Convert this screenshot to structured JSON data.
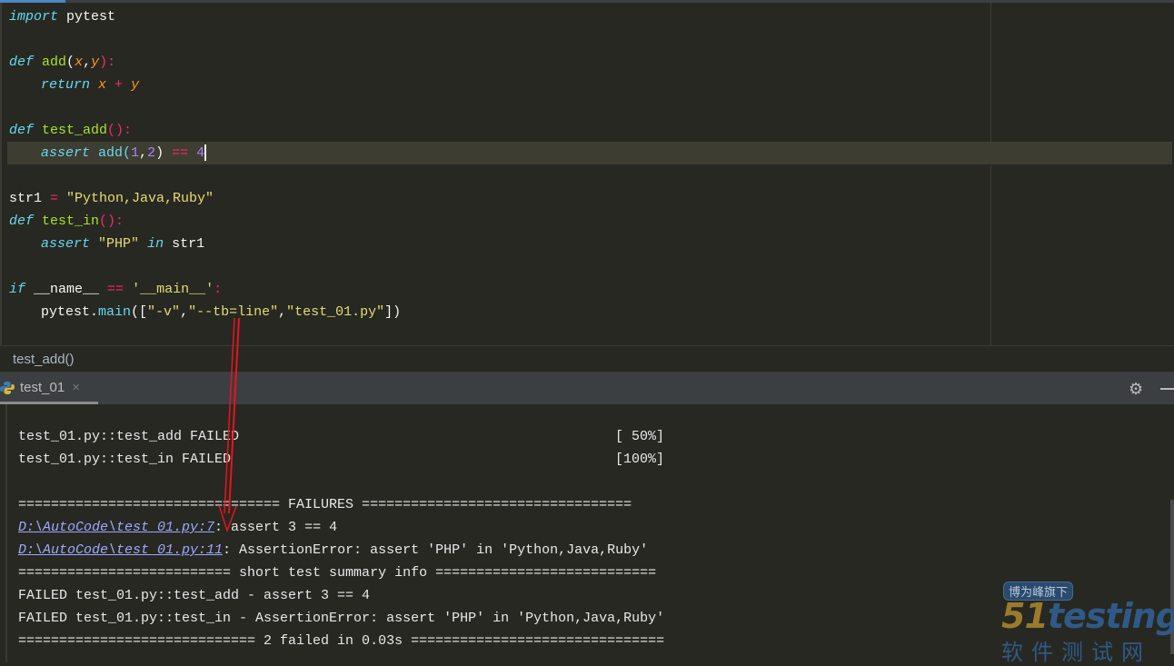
{
  "editor": {
    "lines": {
      "l1": [
        "import",
        " pytest"
      ],
      "l3": [
        "def",
        " ",
        "add",
        "(",
        "x",
        ",",
        "y",
        "):"
      ],
      "l4": [
        "return",
        " ",
        "x",
        " + ",
        "y"
      ],
      "l6": [
        "def",
        " ",
        "test_add",
        "():"
      ],
      "l7": [
        "assert",
        " add(",
        "1",
        ",",
        "2",
        ") ",
        "==",
        "4"
      ],
      "l9": [
        "str1 ",
        "=",
        " \"Python,Java,Ruby\""
      ],
      "l10": [
        "def",
        " ",
        "test_in",
        "():"
      ],
      "l11": [
        "assert",
        " ",
        "\"PHP\"",
        " ",
        "in",
        " str1"
      ],
      "l13": [
        "if",
        " __name__ ",
        "==",
        " ",
        "'__main__'",
        ":"
      ],
      "l14": [
        "pytest.",
        "main",
        "([",
        "\"-v\"",
        ",",
        "\"--tb=line\"",
        ",",
        "\"test_01.py\"",
        "])"
      ]
    }
  },
  "breadcrumb": "test_add()",
  "run_tab": {
    "label": "test_01",
    "close": "×",
    "icon": "python-icon"
  },
  "toolbar": {
    "settings_icon": "gear-icon",
    "hide_icon": "minimize-icon"
  },
  "console": {
    "lines": [
      {
        "text": "test_01.py::test_add FAILED",
        "progress": "[ 50%]"
      },
      {
        "text": "test_01.py::test_in FAILED",
        "progress": "[100%]"
      },
      {
        "text": ""
      },
      {
        "text": "================================ FAILURES ================================="
      },
      {
        "link": "D:\\AutoCode\\test_01.py:7",
        "text": ": assert 3 == 4"
      },
      {
        "link": "D:\\AutoCode\\test_01.py:11",
        "text": ": AssertionError: assert 'PHP' in 'Python,Java,Ruby'"
      },
      {
        "text": "========================== short test summary info ==========================="
      },
      {
        "text": "FAILED test_01.py::test_add - assert 3 == 4"
      },
      {
        "text": "FAILED test_01.py::test_in - AssertionError: assert 'PHP' in 'Python,Java,Ruby'"
      },
      {
        "text": "============================= 2 failed in 0.03s ==============================="
      }
    ]
  },
  "watermark": {
    "top": "博为峰旗下",
    "brand": "51testing",
    "bottom": "软件测试网"
  },
  "colors": {
    "keyword": "#66d9ef",
    "function": "#a6e22e",
    "string": "#e6db74",
    "number": "#ae81ff",
    "operator": "#f92672",
    "annotation_arrow": "#e8141e"
  }
}
